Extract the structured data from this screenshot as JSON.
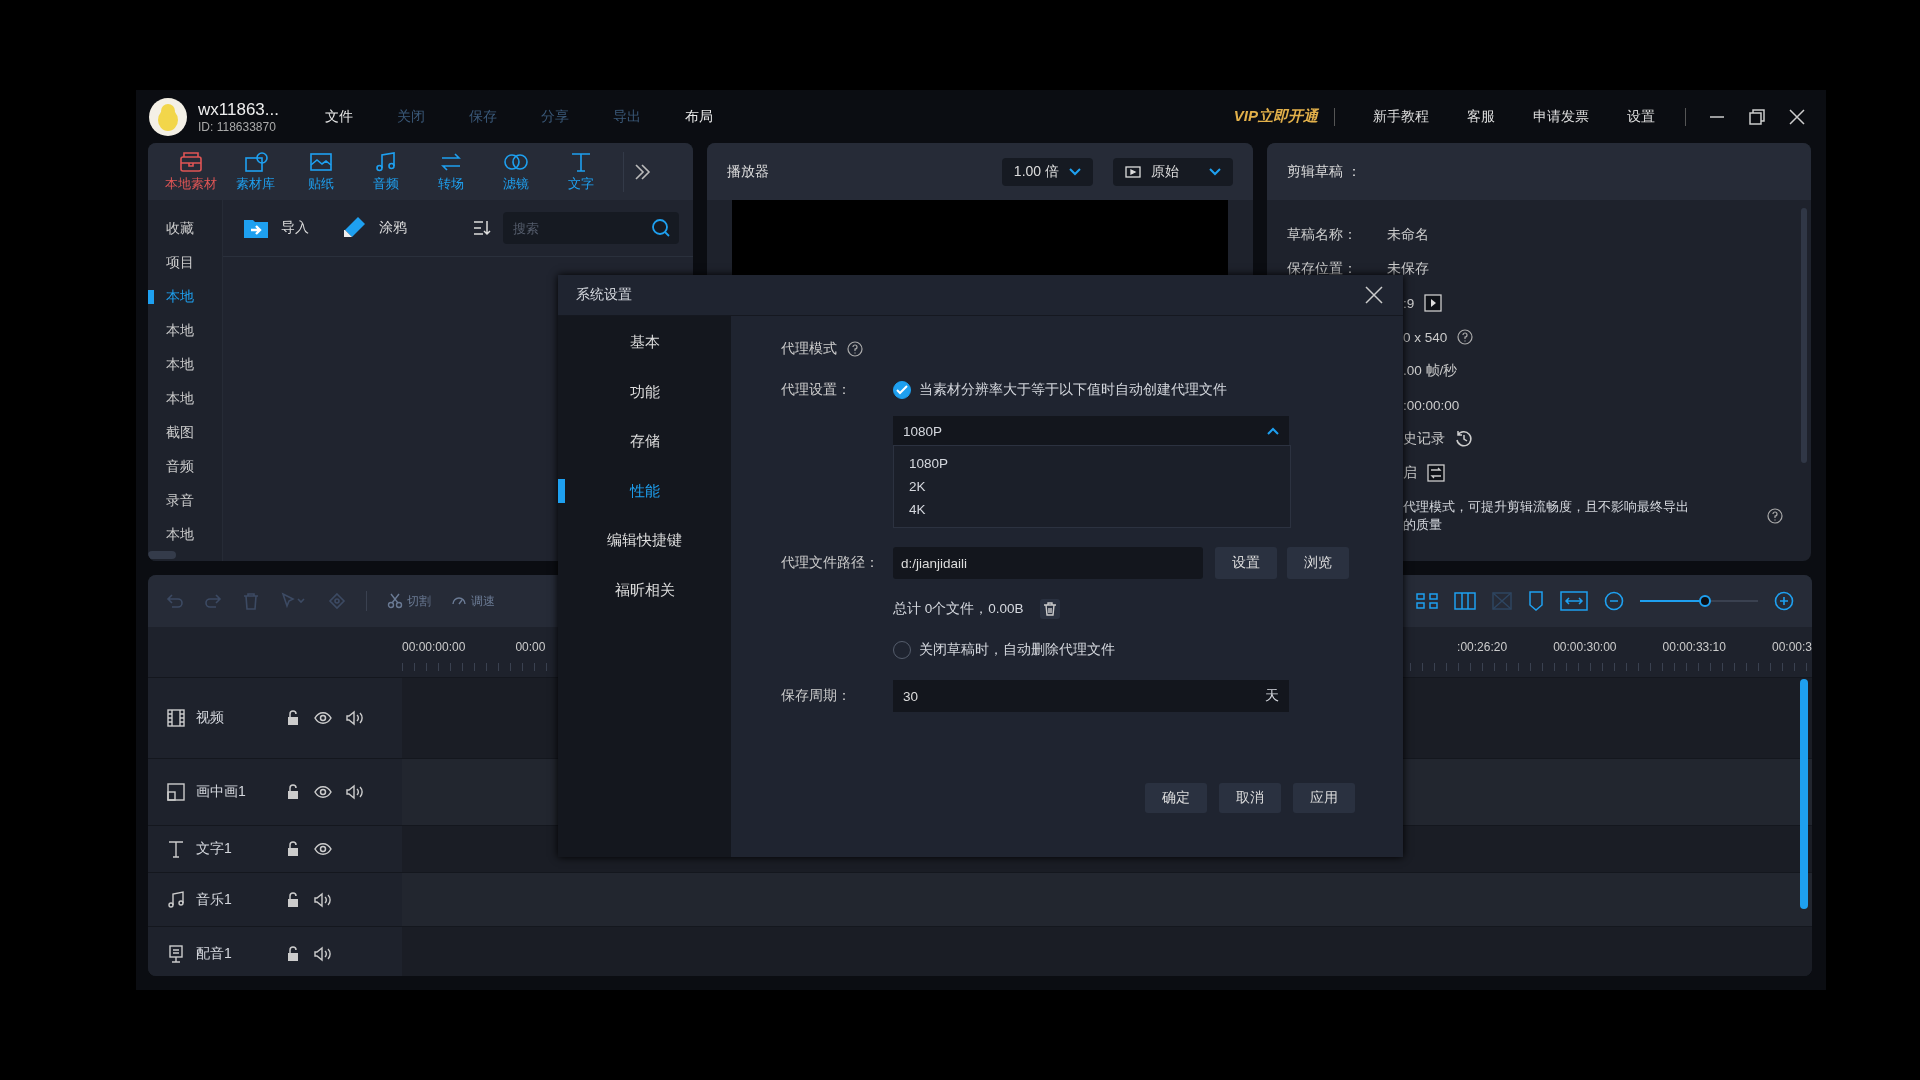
{
  "user": {
    "name": "wx11863...",
    "id": "ID: 118633870"
  },
  "menu": [
    {
      "label": "文件",
      "disabled": false
    },
    {
      "label": "关闭",
      "disabled": true
    },
    {
      "label": "保存",
      "disabled": true
    },
    {
      "label": "分享",
      "disabled": true
    },
    {
      "label": "导出",
      "disabled": true
    },
    {
      "label": "布局",
      "disabled": false
    }
  ],
  "vip": "VIP立即开通",
  "top_links": [
    "新手教程",
    "客服",
    "申请发票",
    "设置"
  ],
  "media_tabs": [
    {
      "label": "本地素材",
      "selected": true
    },
    {
      "label": "素材库",
      "selected": false
    },
    {
      "label": "贴纸",
      "selected": false
    },
    {
      "label": "音频",
      "selected": false
    },
    {
      "label": "转场",
      "selected": false
    },
    {
      "label": "滤镜",
      "selected": false
    },
    {
      "label": "文字",
      "selected": false
    }
  ],
  "media_sidebar": [
    {
      "label": "收藏",
      "selected": false
    },
    {
      "label": "项目",
      "selected": false
    },
    {
      "label": "本地",
      "selected": true
    },
    {
      "label": "本地",
      "selected": false
    },
    {
      "label": "本地",
      "selected": false
    },
    {
      "label": "本地",
      "selected": false
    },
    {
      "label": "截图",
      "selected": false
    },
    {
      "label": "音频",
      "selected": false
    },
    {
      "label": "录音",
      "selected": false
    },
    {
      "label": "本地",
      "selected": false
    }
  ],
  "media_toolbar": {
    "import": "导入",
    "doodle": "涂鸦",
    "search_placeholder": "搜索"
  },
  "player": {
    "title": "播放器",
    "speed": "1.00 倍",
    "ratio": "原始"
  },
  "draft": {
    "title": "剪辑草稿 ：",
    "fields": [
      {
        "label": "草稿名称：",
        "value": "未命名"
      },
      {
        "label": "保存位置：",
        "value": "未保存"
      }
    ],
    "rows": [
      ":9",
      "0 x 540",
      ".00 帧/秒",
      ":00:00:00",
      "史记录",
      "启"
    ],
    "note": [
      "代理模式，可提升剪辑流畅度，且不影响最终导出",
      "的质量"
    ]
  },
  "timeline": {
    "tools": [
      "切割",
      "调速"
    ],
    "ruler_left": [
      "00:00:00:00",
      "00:00"
    ],
    "ruler_right": [
      ":00:26:20",
      "00:00:30:00",
      "00:00:33:10",
      "00:00:3"
    ],
    "zoom": {
      "level": 0.55
    },
    "tracks": [
      {
        "name": "视频",
        "lock": true,
        "eye": true,
        "sound": true
      },
      {
        "name": "画中画1",
        "lock": true,
        "eye": true,
        "sound": true
      },
      {
        "name": "文字1",
        "lock": true,
        "eye": true,
        "sound": false
      },
      {
        "name": "音乐1",
        "lock": true,
        "eye": false,
        "sound": true
      },
      {
        "name": "配音1",
        "lock": true,
        "eye": false,
        "sound": true
      }
    ]
  },
  "dialog": {
    "title": "系统设置",
    "nav": [
      {
        "label": "基本",
        "selected": false
      },
      {
        "label": "功能",
        "selected": false
      },
      {
        "label": "存储",
        "selected": false
      },
      {
        "label": "性能",
        "selected": true
      },
      {
        "label": "编辑快捷键",
        "selected": false
      },
      {
        "label": "福昕相关",
        "selected": false
      }
    ],
    "proxy_mode": "代理模式",
    "proxy_setting_label": "代理设置：",
    "auto_proxy": {
      "label": "当素材分辨率大于等于以下值时自动创建代理文件",
      "checked": true
    },
    "resolution": {
      "value": "1080P",
      "expanded": true,
      "options": [
        "1080P",
        "2K",
        "4K"
      ]
    },
    "path_label": "代理文件路径：",
    "path": "d:/jianjidaili",
    "path_buttons": [
      "设置",
      "浏览"
    ],
    "total": "总计 0个文件，0.00B",
    "auto_delete": {
      "label": "关闭草稿时，自动删除代理文件",
      "checked": false
    },
    "period_label": "保存周期：",
    "period": "30",
    "period_unit": "天",
    "buttons": [
      "确定",
      "取消",
      "应用"
    ]
  }
}
